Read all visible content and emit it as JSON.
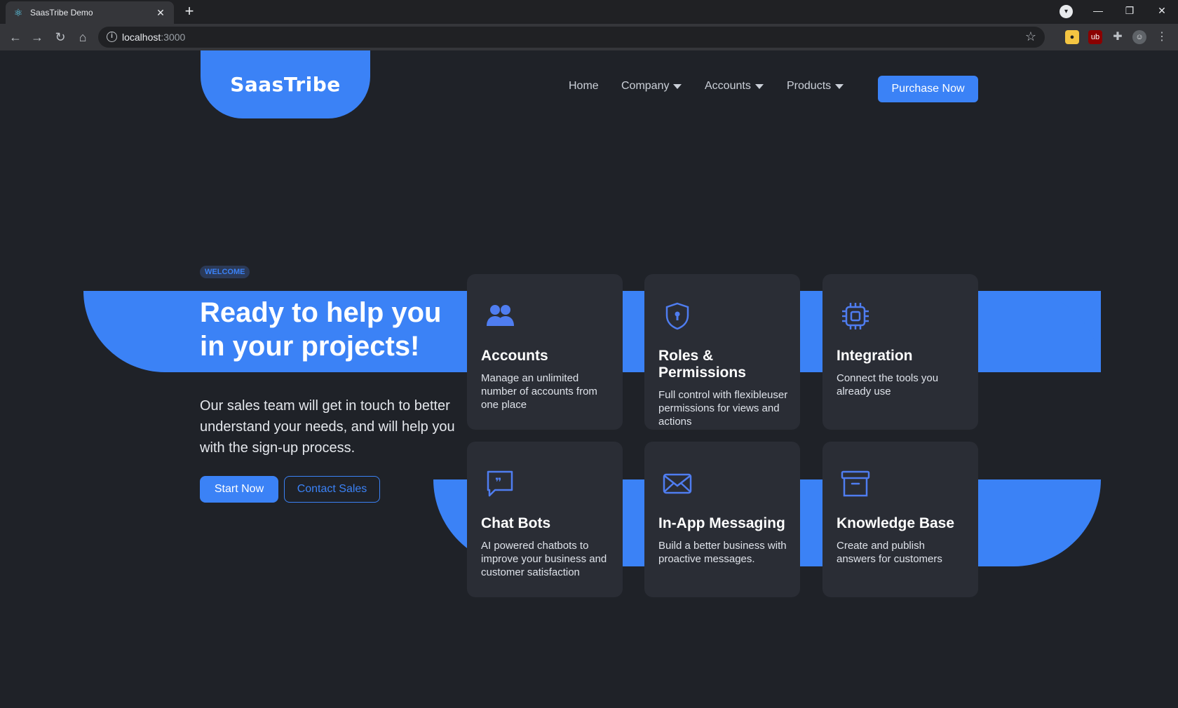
{
  "browser": {
    "tab_title": "SaasTribe Demo",
    "url_host": "localhost",
    "url_port": ":3000"
  },
  "header": {
    "logo": "SaasTribe",
    "nav": [
      {
        "label": "Home",
        "has_dropdown": false
      },
      {
        "label": "Company",
        "has_dropdown": true
      },
      {
        "label": "Accounts",
        "has_dropdown": true
      },
      {
        "label": "Products",
        "has_dropdown": true
      }
    ],
    "cta": "Purchase Now"
  },
  "hero": {
    "badge": "WELCOME",
    "title": "Ready to help you in your projects!",
    "subtitle": "Our sales team will get in touch to better understand your needs, and will help you with the sign-up process.",
    "primary_button": "Start Now",
    "secondary_button": "Contact Sales"
  },
  "features": [
    {
      "icon": "users-icon",
      "title": "Accounts",
      "desc": "Manage an unlimited number of accounts from one place"
    },
    {
      "icon": "shield-icon",
      "title": "Roles & Permissions",
      "desc": "Full control with flexibleuser permissions for views and actions"
    },
    {
      "icon": "chip-icon",
      "title": "Integration",
      "desc": "Connect the tools you already use"
    },
    {
      "icon": "chat-icon",
      "title": "Chat Bots",
      "desc": "AI powered chatbots to improve your business and customer satisfaction"
    },
    {
      "icon": "mail-icon",
      "title": "In-App Messaging",
      "desc": "Build a better business with proactive messages."
    },
    {
      "icon": "archive-icon",
      "title": "Knowledge Base",
      "desc": "Create and publish answers for customers"
    }
  ],
  "colors": {
    "accent": "#3b82f6",
    "background": "#1f2228",
    "card": "#2a2d35"
  }
}
